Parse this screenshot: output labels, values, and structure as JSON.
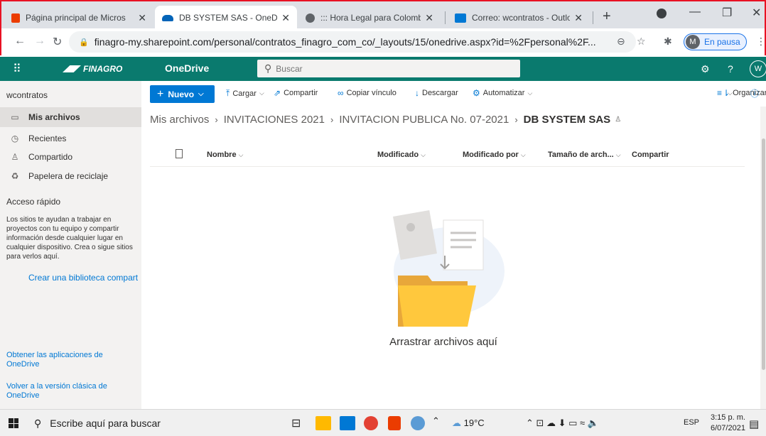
{
  "browser": {
    "tabs": [
      {
        "title": "Página principal de Micros",
        "icon": "office-icon"
      },
      {
        "title": "DB SYSTEM SAS - OneDriv",
        "icon": "onedrive-icon",
        "active": true
      },
      {
        "title": "::: Hora Legal para Colomb",
        "icon": "globe-icon"
      },
      {
        "title": "Correo: wcontratos - Outlo",
        "icon": "outlook-icon"
      }
    ],
    "url": "finagro-my.sharepoint.com/personal/contratos_finagro_com_co/_layouts/15/onedrive.aspx?id=%2Fpersonal%2F...",
    "profile_initial": "M",
    "profile_status": "En pausa"
  },
  "suite": {
    "brand": "FINAGRO",
    "app_name": "OneDrive",
    "search_placeholder": "Buscar",
    "avatar_initial": "W"
  },
  "nav": {
    "user": "wcontratos",
    "items": [
      {
        "label": "Mis archivos",
        "icon": "folder-icon",
        "selected": true
      },
      {
        "label": "Recientes",
        "icon": "clock-icon"
      },
      {
        "label": "Compartido",
        "icon": "people-icon"
      },
      {
        "label": "Papelera de reciclaje",
        "icon": "recycle-bin-icon"
      }
    ],
    "quick_access_title": "Acceso rápido",
    "quick_access_desc": "Los sitios te ayudan a trabajar en proyectos con tu equipo y compartir información desde cualquier lugar en cualquier dispositivo. Crea o sigue sitios para verlos aquí.",
    "create_library": "Crear una biblioteca compart",
    "get_apps": "Obtener las aplicaciones de OneDrive",
    "classic_view": "Volver a la versión clásica de OneDrive"
  },
  "commands": {
    "new": "Nuevo",
    "upload": "Cargar",
    "share": "Compartir",
    "copy_link": "Copiar vínculo",
    "download": "Descargar",
    "automate": "Automatizar",
    "organize": "Organizar"
  },
  "breadcrumb": [
    "Mis archivos",
    "INVITACIONES 2021",
    "INVITACION PUBLICA No. 07-2021",
    "DB SYSTEM SAS"
  ],
  "columns": [
    "Nombre",
    "Modificado",
    "Modificado por",
    "Tamaño de arch...",
    "Compartir"
  ],
  "empty_state": "Arrastrar archivos aquí",
  "taskbar": {
    "search_placeholder": "Escribe aquí para buscar",
    "weather": "19°C",
    "language": "ESP",
    "time": "3:15 p. m.",
    "date": "6/07/2021"
  },
  "colors": {
    "suite_bar": "#0a7a6e",
    "accent": "#0078d4"
  }
}
